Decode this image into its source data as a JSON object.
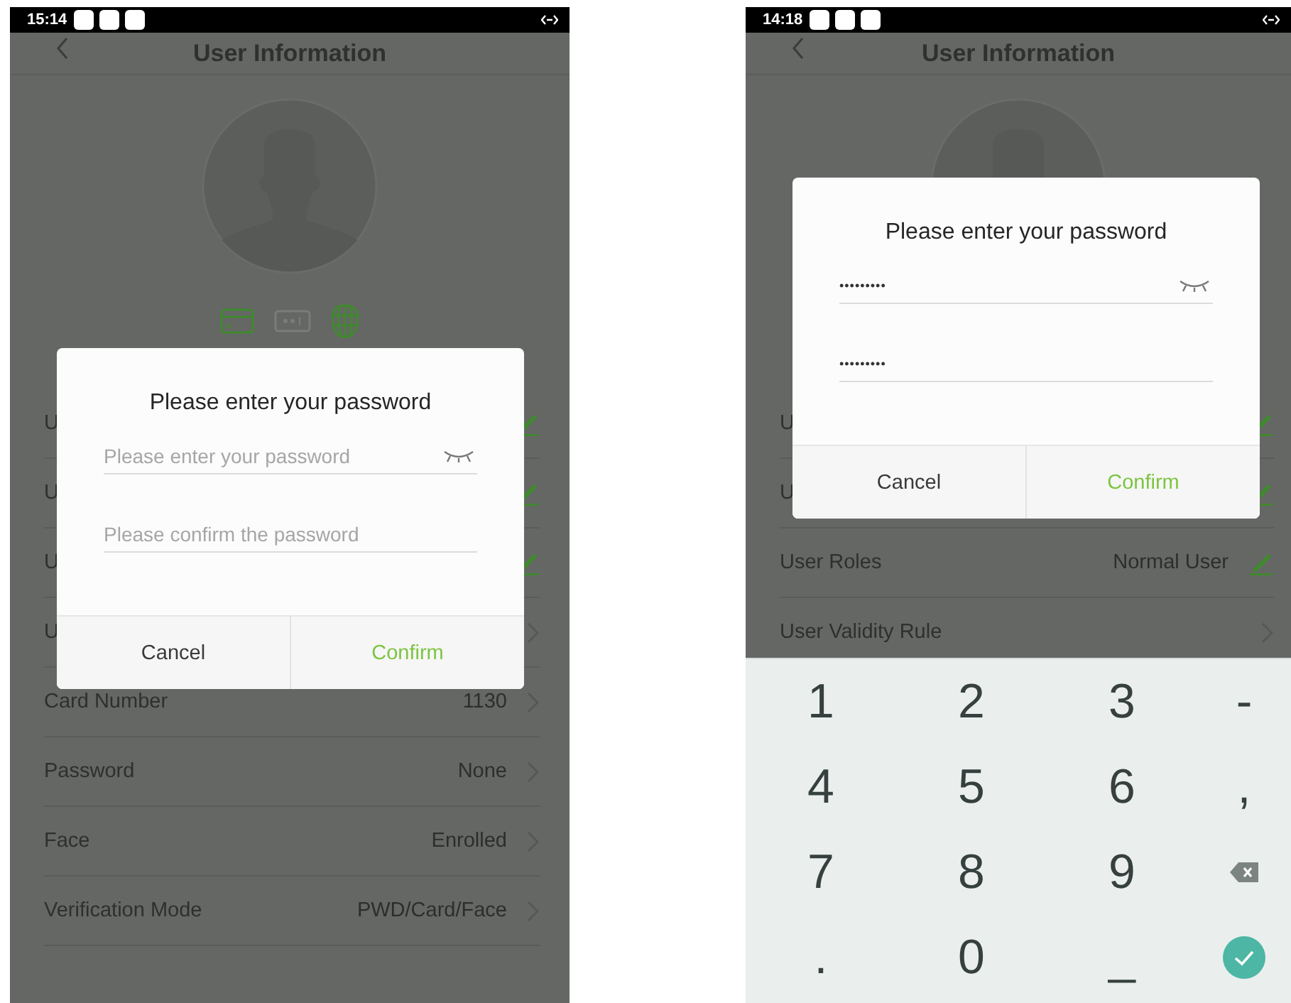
{
  "phones": [
    {
      "status": {
        "time": "15:14"
      },
      "header": {
        "title": "User Information"
      },
      "credentials": [
        {
          "kind": "card",
          "enrolled": true
        },
        {
          "kind": "password",
          "enrolled": false
        },
        {
          "kind": "face",
          "enrolled": true
        }
      ],
      "rows": [
        {
          "label": "U",
          "kind": "edit"
        },
        {
          "label": "U",
          "kind": "edit"
        },
        {
          "label": "U",
          "kind": "edit"
        },
        {
          "label": "U",
          "kind": "link"
        },
        {
          "label": "Card Number",
          "value": "1130",
          "kind": "link"
        },
        {
          "label": "Password",
          "value": "None",
          "kind": "link"
        },
        {
          "label": "Face",
          "value": "Enrolled",
          "kind": "link"
        },
        {
          "label": "Verification Mode",
          "value": "PWD/Card/Face",
          "kind": "link"
        }
      ],
      "dialog": {
        "title": "Please enter your password",
        "fields": [
          {
            "placeholder": "Please enter your password",
            "visibility_toggle": true
          },
          {
            "placeholder": "Please confirm the password",
            "visibility_toggle": false
          }
        ],
        "buttons": [
          {
            "label": "Cancel",
            "kind": "cancel"
          },
          {
            "label": "Confirm",
            "kind": "confirm"
          }
        ]
      }
    },
    {
      "status": {
        "time": "14:18"
      },
      "header": {
        "title": "User Information"
      },
      "rows": [
        {
          "label": "U",
          "kind": "edit"
        },
        {
          "label": "U",
          "kind": "edit"
        },
        {
          "label": "User Roles",
          "value": "Normal User",
          "kind": "edit"
        },
        {
          "label": "User Validity Rule",
          "kind": "link"
        }
      ],
      "dialog": {
        "title": "Please enter your password",
        "fields": [
          {
            "value": "•••••••••",
            "visibility_toggle": true
          },
          {
            "value": "•••••••••",
            "visibility_toggle": false
          }
        ],
        "buttons": [
          {
            "label": "Cancel",
            "kind": "cancel"
          },
          {
            "label": "Confirm",
            "kind": "confirm"
          }
        ]
      },
      "keyboard": {
        "keys": [
          {
            "kind": "char",
            "label": "1"
          },
          {
            "kind": "char",
            "label": "2"
          },
          {
            "kind": "char",
            "label": "3"
          },
          {
            "kind": "char",
            "label": "-"
          },
          {
            "kind": "char",
            "label": "4"
          },
          {
            "kind": "char",
            "label": "5"
          },
          {
            "kind": "char",
            "label": "6"
          },
          {
            "kind": "char",
            "label": ","
          },
          {
            "kind": "char",
            "label": "7"
          },
          {
            "kind": "char",
            "label": "8"
          },
          {
            "kind": "char",
            "label": "9"
          },
          {
            "kind": "backspace"
          },
          {
            "kind": "char",
            "label": "."
          },
          {
            "kind": "char",
            "label": "0"
          },
          {
            "kind": "char",
            "label": "_"
          },
          {
            "kind": "enter"
          }
        ]
      }
    }
  ]
}
